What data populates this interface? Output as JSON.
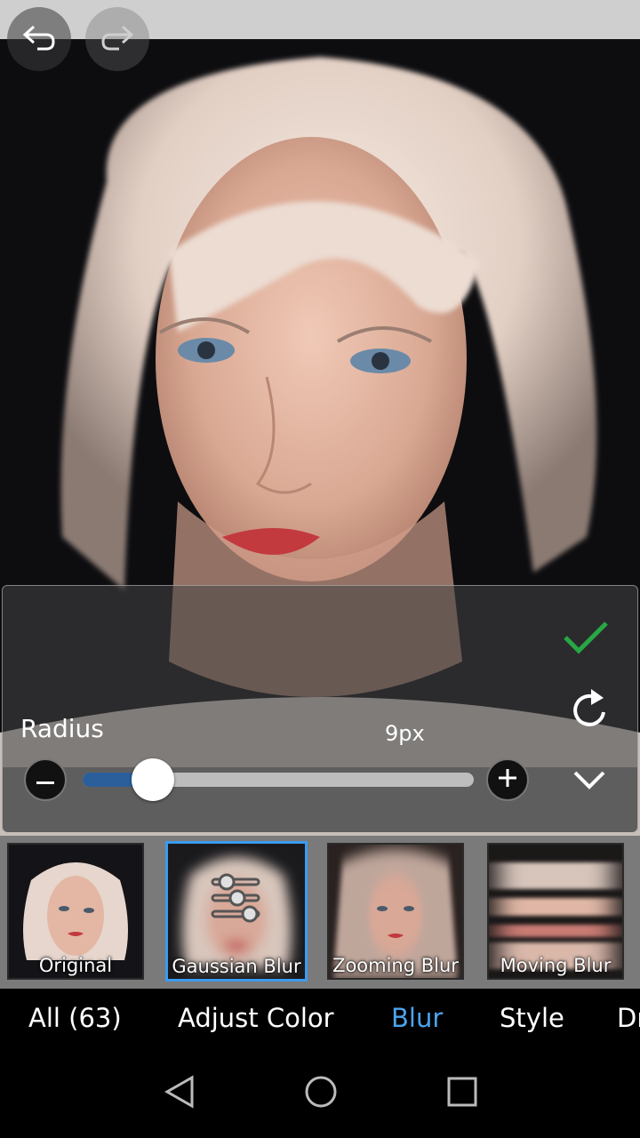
{
  "toolbar": {
    "undo_icon": "undo-icon",
    "redo_icon": "redo-icon"
  },
  "adjust_panel": {
    "label": "Radius",
    "value": "9px",
    "slider_fraction": 0.18,
    "confirm_icon": "checkmark-icon",
    "reset_icon": "reset-icon",
    "collapse_icon": "chevron-down-icon",
    "minus_icon": "minus-icon",
    "plus_icon": "plus-icon",
    "accent_color": "#2b5f9b",
    "confirm_color": "#27a844"
  },
  "effects": [
    {
      "label": "Original"
    },
    {
      "label": "Gaussian Blur",
      "selected": true
    },
    {
      "label": "Zooming Blur"
    },
    {
      "label": "Moving Blur"
    }
  ],
  "categories": [
    {
      "label": "All (63)"
    },
    {
      "label": "Adjust Color"
    },
    {
      "label": "Blur",
      "active": true
    },
    {
      "label": "Style"
    },
    {
      "label": "Dr"
    }
  ],
  "colors": {
    "selected_accent": "#3b9bf0",
    "active_tab": "#4aa3ee"
  },
  "nav": {
    "back_icon": "back-triangle-icon",
    "home_icon": "home-circle-icon",
    "recents_icon": "recents-square-icon"
  }
}
